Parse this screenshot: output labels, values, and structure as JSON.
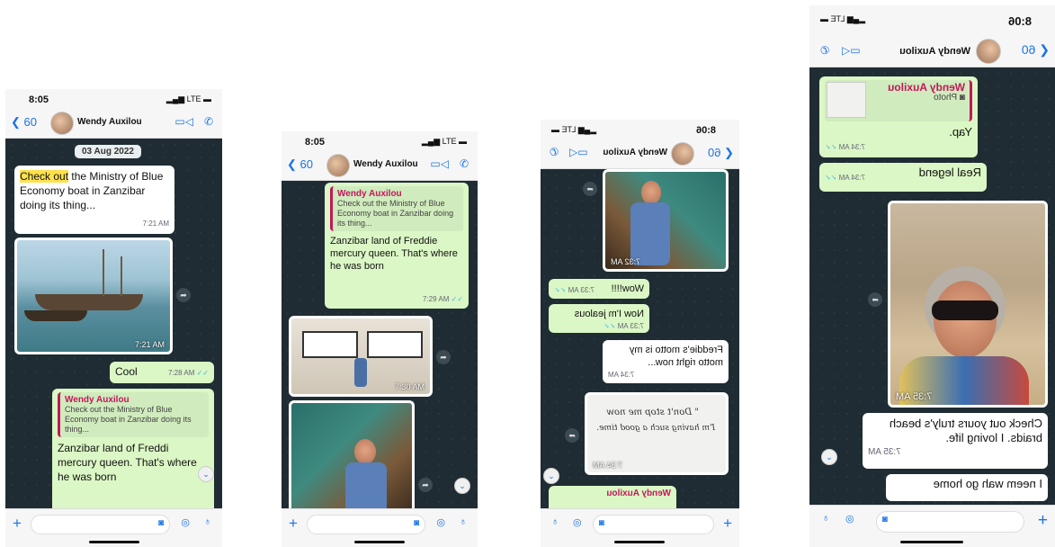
{
  "screens": [
    {
      "status": {
        "time": "8:05",
        "signal": "LTE"
      },
      "header": {
        "back_count": "60",
        "contact": "Wendy Auxilou"
      },
      "date_chip": "03 Aug 2022",
      "msg1": {
        "highlight": "Check out",
        "rest": " the Ministry of Blue Economy boat in Zanzibar doing its thing...",
        "time": "7:21 AM"
      },
      "img1": {
        "time": "7:21 AM"
      },
      "msg2": {
        "text": "Cool",
        "time": "7:28 AM"
      },
      "msg3": {
        "quote_name": "Wendy Auxilou",
        "quote_text": "Check out the Ministry of Blue Economy boat in Zanzibar doing its thing...",
        "text": "Zanzibar land of Freddi mercury queen. That's where he was born"
      }
    },
    {
      "status": {
        "time": "8:05",
        "signal": "LTE"
      },
      "header": {
        "back_count": "60",
        "contact": "Wendy Auxilou"
      },
      "msg1": {
        "quote_name": "Wendy Auxilou",
        "quote_text": "Check out the Ministry of Blue Economy boat in Zanzibar doing its thing...",
        "text": "Zanzibar land of Freddie mercury queen. That's where he was born",
        "time": "7:29 AM"
      },
      "img1": {
        "time": "7:30 AM"
      }
    },
    {
      "status": {
        "time": "8:06",
        "signal": "LTE"
      },
      "header": {
        "back_count": "60",
        "contact": "Wendy Auxilou"
      },
      "img1": {
        "time": "7:32 AM"
      },
      "msg1": {
        "text": "Wow!!!!",
        "time": "7:33 AM"
      },
      "msg2": {
        "text": "Now I'm jealous",
        "time": "7:33 AM"
      },
      "msg3": {
        "text": "Freddie's motto is my motto right now...",
        "time": "7:34 AM"
      },
      "note": {
        "line1": "\" Don't stop me now",
        "line2": "I'm having such a good time.",
        "time": "7:34 AM"
      },
      "msg4": {
        "quote_name": "Wendy Auxilou"
      }
    },
    {
      "status": {
        "time": "8:06",
        "signal": "LTE"
      },
      "header": {
        "back_count": "60",
        "contact": "Wendy Auxilou"
      },
      "msg1": {
        "quote_name": "Wendy Auxilou",
        "quote_text": "Photo",
        "text": "Yap.",
        "time": "7:34 AM"
      },
      "msg2": {
        "text": "Real legend",
        "time": "7:34 AM"
      },
      "img1": {
        "time": "7:35 AM"
      },
      "msg3": {
        "text": "Check out yours truly's beach braids. I loving life.",
        "time": "7:35 AM"
      },
      "msg4": {
        "text": "I neem wah go home"
      }
    }
  ],
  "icons": {
    "back": "chevron-left",
    "video": "video-icon",
    "call": "phone-icon",
    "plus": "plus-icon",
    "sticker": "sticker-icon",
    "camera": "camera-icon",
    "mic": "mic-icon",
    "forward": "forward-icon",
    "scroll": "chevron-down-icon"
  }
}
